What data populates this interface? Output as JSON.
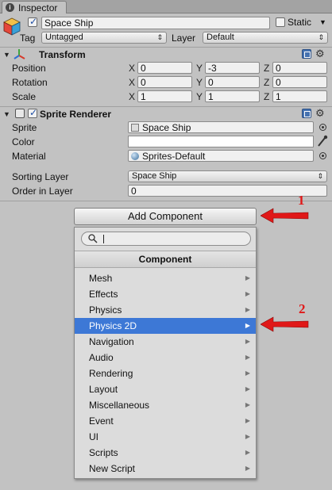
{
  "tab": {
    "label": "Inspector"
  },
  "object": {
    "name": "Space Ship",
    "active": true,
    "static_label": "Static",
    "static": false
  },
  "tag": {
    "label": "Tag",
    "value": "Untagged"
  },
  "layer": {
    "label": "Layer",
    "value": "Default"
  },
  "transform": {
    "title": "Transform",
    "position": {
      "label": "Position",
      "x": "0",
      "y": "-3",
      "z": "0"
    },
    "rotation": {
      "label": "Rotation",
      "x": "0",
      "y": "0",
      "z": "0"
    },
    "scale": {
      "label": "Scale",
      "x": "1",
      "y": "1",
      "z": "1"
    }
  },
  "axes": {
    "x": "X",
    "y": "Y",
    "z": "Z"
  },
  "sprite_renderer": {
    "title": "Sprite Renderer",
    "enabled": true,
    "sprite": {
      "label": "Sprite",
      "value": "Space Ship"
    },
    "color": {
      "label": "Color",
      "value": "#ffffff"
    },
    "material": {
      "label": "Material",
      "value": "Sprites-Default"
    },
    "sorting_layer": {
      "label": "Sorting Layer",
      "value": "Space Ship"
    },
    "order_in_layer": {
      "label": "Order in Layer",
      "value": "0"
    }
  },
  "add_component": {
    "button_label": "Add Component",
    "search_value": "",
    "header": "Component",
    "items": [
      {
        "label": "Mesh",
        "selected": false
      },
      {
        "label": "Effects",
        "selected": false
      },
      {
        "label": "Physics",
        "selected": false
      },
      {
        "label": "Physics 2D",
        "selected": true
      },
      {
        "label": "Navigation",
        "selected": false
      },
      {
        "label": "Audio",
        "selected": false
      },
      {
        "label": "Rendering",
        "selected": false
      },
      {
        "label": "Layout",
        "selected": false
      },
      {
        "label": "Miscellaneous",
        "selected": false
      },
      {
        "label": "Event",
        "selected": false
      },
      {
        "label": "UI",
        "selected": false
      },
      {
        "label": "Scripts",
        "selected": false
      },
      {
        "label": "New Script",
        "selected": false
      }
    ]
  },
  "annotations": {
    "step1": "1",
    "step2": "2",
    "arrow_color": "#e01818"
  },
  "colors": {
    "selection": "#3d78d6",
    "panel": "#c2c2c2"
  }
}
